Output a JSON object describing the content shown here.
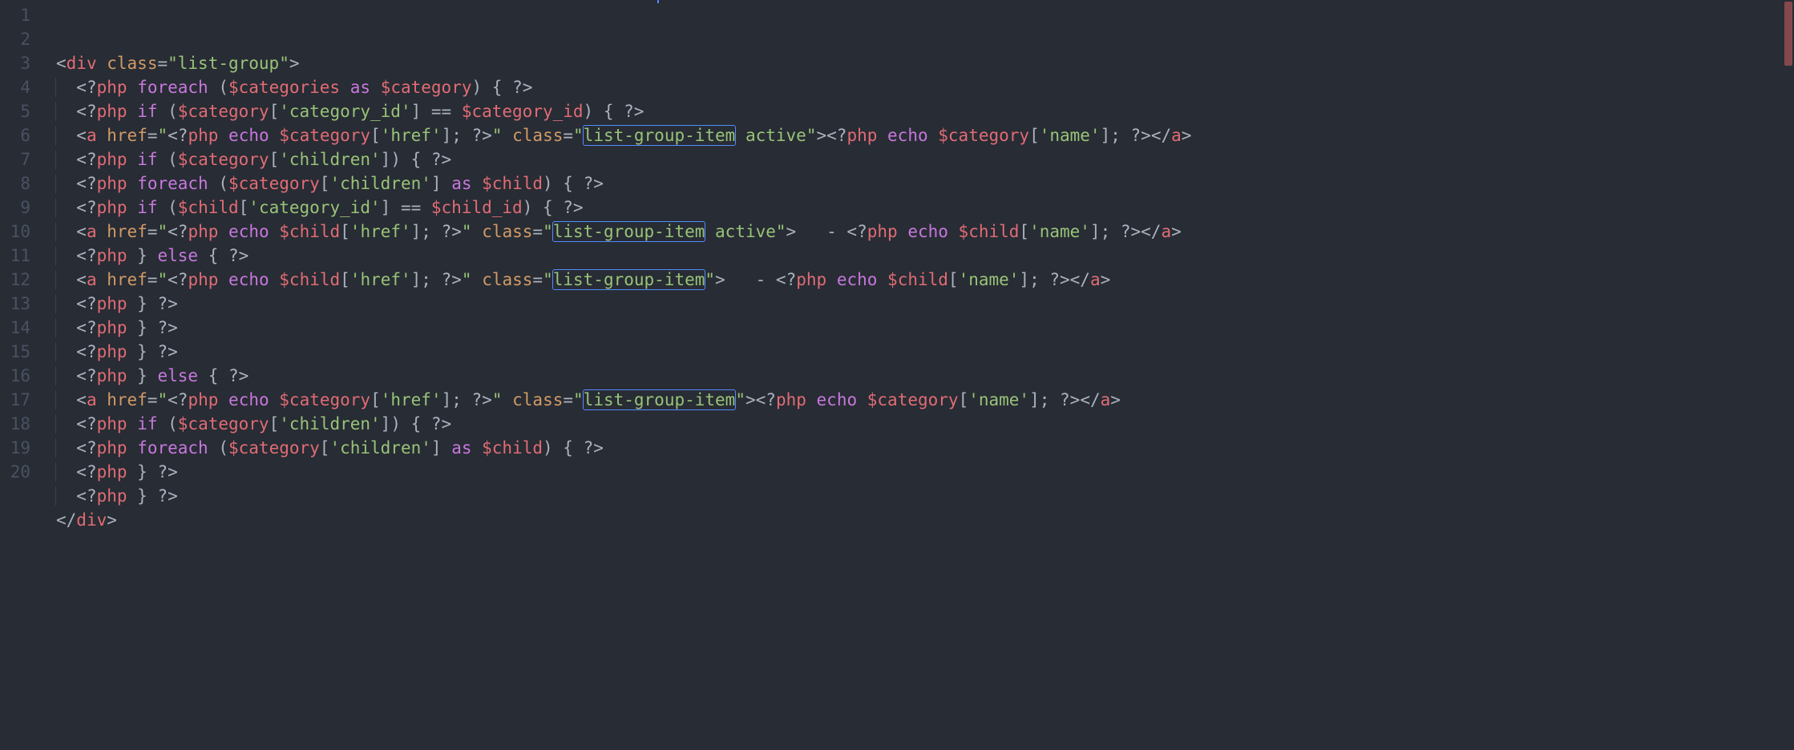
{
  "lineNumbers": [
    "1",
    "2",
    "3",
    "4",
    "5",
    "6",
    "7",
    "8",
    "9",
    "10",
    "11",
    "12",
    "13",
    "14",
    "15",
    "16",
    "17",
    "18",
    "19",
    "20"
  ],
  "code": [
    {
      "indent": 0,
      "tokens": [
        [
          "punc",
          "<"
        ],
        [
          "tag",
          "div"
        ],
        [
          "default",
          " "
        ],
        [
          "attr",
          "class"
        ],
        [
          "default",
          "="
        ],
        [
          "string",
          "\"list-group\""
        ],
        [
          "punc",
          ">"
        ]
      ]
    },
    {
      "indent": 1,
      "tokens": [
        [
          "delim",
          "<?"
        ],
        [
          "tag",
          "php"
        ],
        [
          "default",
          " "
        ],
        [
          "keyword",
          "foreach"
        ],
        [
          "default",
          " ("
        ],
        [
          "var",
          "$categories"
        ],
        [
          "default",
          " "
        ],
        [
          "keyword",
          "as"
        ],
        [
          "default",
          " "
        ],
        [
          "var",
          "$category"
        ],
        [
          "default",
          ") { "
        ],
        [
          "delim",
          "?>"
        ]
      ]
    },
    {
      "indent": 1,
      "tokens": [
        [
          "delim",
          "<?"
        ],
        [
          "tag",
          "php"
        ],
        [
          "default",
          " "
        ],
        [
          "keyword",
          "if"
        ],
        [
          "default",
          " ("
        ],
        [
          "var",
          "$category"
        ],
        [
          "default",
          "["
        ],
        [
          "string",
          "'category_id'"
        ],
        [
          "default",
          "] == "
        ],
        [
          "var",
          "$category_id"
        ],
        [
          "default",
          ") { "
        ],
        [
          "delim",
          "?>"
        ]
      ]
    },
    {
      "indent": 1,
      "tokens": [
        [
          "punc",
          "<"
        ],
        [
          "tag",
          "a"
        ],
        [
          "default",
          " "
        ],
        [
          "attr",
          "href"
        ],
        [
          "default",
          "="
        ],
        [
          "string",
          "\""
        ],
        [
          "delim",
          "<?"
        ],
        [
          "tag",
          "php"
        ],
        [
          "default",
          " "
        ],
        [
          "keyword",
          "echo"
        ],
        [
          "default",
          " "
        ],
        [
          "var",
          "$category"
        ],
        [
          "default",
          "["
        ],
        [
          "string",
          "'href'"
        ],
        [
          "default",
          "]; "
        ],
        [
          "delim",
          "?>"
        ],
        [
          "string",
          "\""
        ],
        [
          "default",
          " "
        ],
        [
          "attr",
          "class"
        ],
        [
          "default",
          "="
        ],
        [
          "string",
          "\""
        ],
        [
          "selstring",
          "list-group-item"
        ],
        [
          "string",
          " active\""
        ],
        [
          "punc",
          ">"
        ],
        [
          "delim",
          "<?"
        ],
        [
          "tag",
          "php"
        ],
        [
          "default",
          " "
        ],
        [
          "keyword",
          "echo"
        ],
        [
          "default",
          " "
        ],
        [
          "var",
          "$category"
        ],
        [
          "default",
          "["
        ],
        [
          "string",
          "'name'"
        ],
        [
          "default",
          "]; "
        ],
        [
          "delim",
          "?>"
        ],
        [
          "punc",
          "</"
        ],
        [
          "tag",
          "a"
        ],
        [
          "punc",
          ">"
        ]
      ]
    },
    {
      "indent": 1,
      "tokens": [
        [
          "delim",
          "<?"
        ],
        [
          "tag",
          "php"
        ],
        [
          "default",
          " "
        ],
        [
          "keyword",
          "if"
        ],
        [
          "default",
          " ("
        ],
        [
          "var",
          "$category"
        ],
        [
          "default",
          "["
        ],
        [
          "string",
          "'children'"
        ],
        [
          "default",
          "]) { "
        ],
        [
          "delim",
          "?>"
        ]
      ]
    },
    {
      "indent": 1,
      "tokens": [
        [
          "delim",
          "<?"
        ],
        [
          "tag",
          "php"
        ],
        [
          "default",
          " "
        ],
        [
          "keyword",
          "foreach"
        ],
        [
          "default",
          " ("
        ],
        [
          "var",
          "$category"
        ],
        [
          "default",
          "["
        ],
        [
          "string",
          "'children'"
        ],
        [
          "default",
          "] "
        ],
        [
          "keyword",
          "as"
        ],
        [
          "default",
          " "
        ],
        [
          "var",
          "$child"
        ],
        [
          "default",
          ") { "
        ],
        [
          "delim",
          "?>"
        ]
      ]
    },
    {
      "indent": 1,
      "tokens": [
        [
          "delim",
          "<?"
        ],
        [
          "tag",
          "php"
        ],
        [
          "default",
          " "
        ],
        [
          "keyword",
          "if"
        ],
        [
          "default",
          " ("
        ],
        [
          "var",
          "$child"
        ],
        [
          "default",
          "["
        ],
        [
          "string",
          "'category_id'"
        ],
        [
          "default",
          "] == "
        ],
        [
          "var",
          "$child_id"
        ],
        [
          "default",
          ") { "
        ],
        [
          "delim",
          "?>"
        ]
      ]
    },
    {
      "indent": 1,
      "tokens": [
        [
          "punc",
          "<"
        ],
        [
          "tag",
          "a"
        ],
        [
          "default",
          " "
        ],
        [
          "attr",
          "href"
        ],
        [
          "default",
          "="
        ],
        [
          "string",
          "\""
        ],
        [
          "delim",
          "<?"
        ],
        [
          "tag",
          "php"
        ],
        [
          "default",
          " "
        ],
        [
          "keyword",
          "echo"
        ],
        [
          "default",
          " "
        ],
        [
          "var",
          "$child"
        ],
        [
          "default",
          "["
        ],
        [
          "string",
          "'href'"
        ],
        [
          "default",
          "]; "
        ],
        [
          "delim",
          "?>"
        ],
        [
          "string",
          "\""
        ],
        [
          "default",
          " "
        ],
        [
          "attr",
          "class"
        ],
        [
          "default",
          "="
        ],
        [
          "string",
          "\""
        ],
        [
          "selstring",
          "list-group-item"
        ],
        [
          "string",
          " active\""
        ],
        [
          "punc",
          ">"
        ],
        [
          "default",
          "   - "
        ],
        [
          "delim",
          "<?"
        ],
        [
          "tag",
          "php"
        ],
        [
          "default",
          " "
        ],
        [
          "keyword",
          "echo"
        ],
        [
          "default",
          " "
        ],
        [
          "var",
          "$child"
        ],
        [
          "default",
          "["
        ],
        [
          "string",
          "'name'"
        ],
        [
          "default",
          "]; "
        ],
        [
          "delim",
          "?>"
        ],
        [
          "punc",
          "</"
        ],
        [
          "tag",
          "a"
        ],
        [
          "punc",
          ">"
        ]
      ]
    },
    {
      "indent": 1,
      "tokens": [
        [
          "delim",
          "<?"
        ],
        [
          "tag",
          "php"
        ],
        [
          "default",
          " } "
        ],
        [
          "keyword",
          "else"
        ],
        [
          "default",
          " { "
        ],
        [
          "delim",
          "?>"
        ]
      ]
    },
    {
      "indent": 1,
      "tokens": [
        [
          "punc",
          "<"
        ],
        [
          "tag",
          "a"
        ],
        [
          "default",
          " "
        ],
        [
          "attr",
          "href"
        ],
        [
          "default",
          "="
        ],
        [
          "string",
          "\""
        ],
        [
          "delim",
          "<?"
        ],
        [
          "tag",
          "php"
        ],
        [
          "default",
          " "
        ],
        [
          "keyword",
          "echo"
        ],
        [
          "default",
          " "
        ],
        [
          "var",
          "$child"
        ],
        [
          "default",
          "["
        ],
        [
          "string",
          "'href'"
        ],
        [
          "default",
          "]; "
        ],
        [
          "delim",
          "?>"
        ],
        [
          "string",
          "\""
        ],
        [
          "default",
          " "
        ],
        [
          "attr",
          "class"
        ],
        [
          "default",
          "="
        ],
        [
          "string",
          "\""
        ],
        [
          "selstring",
          "list-group-item"
        ],
        [
          "string",
          "\""
        ],
        [
          "punc",
          ">"
        ],
        [
          "default",
          "   - "
        ],
        [
          "delim",
          "<?"
        ],
        [
          "tag",
          "php"
        ],
        [
          "default",
          " "
        ],
        [
          "keyword",
          "echo"
        ],
        [
          "default",
          " "
        ],
        [
          "var",
          "$child"
        ],
        [
          "default",
          "["
        ],
        [
          "string",
          "'name'"
        ],
        [
          "default",
          "]; "
        ],
        [
          "delim",
          "?>"
        ],
        [
          "punc",
          "</"
        ],
        [
          "tag",
          "a"
        ],
        [
          "punc",
          ">"
        ]
      ]
    },
    {
      "indent": 1,
      "tokens": [
        [
          "delim",
          "<?"
        ],
        [
          "tag",
          "php"
        ],
        [
          "default",
          " } "
        ],
        [
          "delim",
          "?>"
        ]
      ]
    },
    {
      "indent": 1,
      "tokens": [
        [
          "delim",
          "<?"
        ],
        [
          "tag",
          "php"
        ],
        [
          "default",
          " } "
        ],
        [
          "delim",
          "?>"
        ]
      ]
    },
    {
      "indent": 1,
      "tokens": [
        [
          "delim",
          "<?"
        ],
        [
          "tag",
          "php"
        ],
        [
          "default",
          " } "
        ],
        [
          "delim",
          "?>"
        ]
      ]
    },
    {
      "indent": 1,
      "tokens": [
        [
          "delim",
          "<?"
        ],
        [
          "tag",
          "php"
        ],
        [
          "default",
          " } "
        ],
        [
          "keyword",
          "else"
        ],
        [
          "default",
          " { "
        ],
        [
          "delim",
          "?>"
        ]
      ]
    },
    {
      "indent": 1,
      "tokens": [
        [
          "punc",
          "<"
        ],
        [
          "tag",
          "a"
        ],
        [
          "default",
          " "
        ],
        [
          "attr",
          "href"
        ],
        [
          "default",
          "="
        ],
        [
          "string",
          "\""
        ],
        [
          "delim",
          "<?"
        ],
        [
          "tag",
          "php"
        ],
        [
          "default",
          " "
        ],
        [
          "keyword",
          "echo"
        ],
        [
          "default",
          " "
        ],
        [
          "var",
          "$category"
        ],
        [
          "default",
          "["
        ],
        [
          "string",
          "'href'"
        ],
        [
          "default",
          "]; "
        ],
        [
          "delim",
          "?>"
        ],
        [
          "string",
          "\""
        ],
        [
          "default",
          " "
        ],
        [
          "attr",
          "class"
        ],
        [
          "default",
          "="
        ],
        [
          "string",
          "\""
        ],
        [
          "selstring",
          "list-group-item"
        ],
        [
          "string",
          "\""
        ],
        [
          "punc",
          ">"
        ],
        [
          "delim",
          "<?"
        ],
        [
          "tag",
          "php"
        ],
        [
          "default",
          " "
        ],
        [
          "keyword",
          "echo"
        ],
        [
          "default",
          " "
        ],
        [
          "var",
          "$category"
        ],
        [
          "default",
          "["
        ],
        [
          "string",
          "'name'"
        ],
        [
          "default",
          "]; "
        ],
        [
          "delim",
          "?>"
        ],
        [
          "punc",
          "</"
        ],
        [
          "tag",
          "a"
        ],
        [
          "punc",
          ">"
        ]
      ]
    },
    {
      "indent": 1,
      "tokens": [
        [
          "delim",
          "<?"
        ],
        [
          "tag",
          "php"
        ],
        [
          "default",
          " "
        ],
        [
          "keyword",
          "if"
        ],
        [
          "default",
          " ("
        ],
        [
          "var",
          "$category"
        ],
        [
          "default",
          "["
        ],
        [
          "string",
          "'children'"
        ],
        [
          "default",
          "]) { "
        ],
        [
          "delim",
          "?>"
        ]
      ]
    },
    {
      "indent": 1,
      "tokens": [
        [
          "delim",
          "<?"
        ],
        [
          "tag",
          "php"
        ],
        [
          "default",
          " "
        ],
        [
          "keyword",
          "foreach"
        ],
        [
          "default",
          " ("
        ],
        [
          "var",
          "$category"
        ],
        [
          "default",
          "["
        ],
        [
          "string",
          "'children'"
        ],
        [
          "default",
          "] "
        ],
        [
          "keyword",
          "as"
        ],
        [
          "default",
          " "
        ],
        [
          "var",
          "$child"
        ],
        [
          "default",
          ") { "
        ],
        [
          "delim",
          "?>"
        ]
      ]
    },
    {
      "indent": 1,
      "tokens": [
        [
          "delim",
          "<?"
        ],
        [
          "tag",
          "php"
        ],
        [
          "default",
          " } "
        ],
        [
          "delim",
          "?>"
        ]
      ]
    },
    {
      "indent": 1,
      "tokens": [
        [
          "delim",
          "<?"
        ],
        [
          "tag",
          "php"
        ],
        [
          "default",
          " } "
        ],
        [
          "delim",
          "?>"
        ]
      ]
    },
    {
      "indent": 0,
      "tokens": [
        [
          "punc",
          "</"
        ],
        [
          "tag",
          "div"
        ],
        [
          "punc",
          ">"
        ]
      ]
    }
  ],
  "highlightedText": "list-group-item"
}
